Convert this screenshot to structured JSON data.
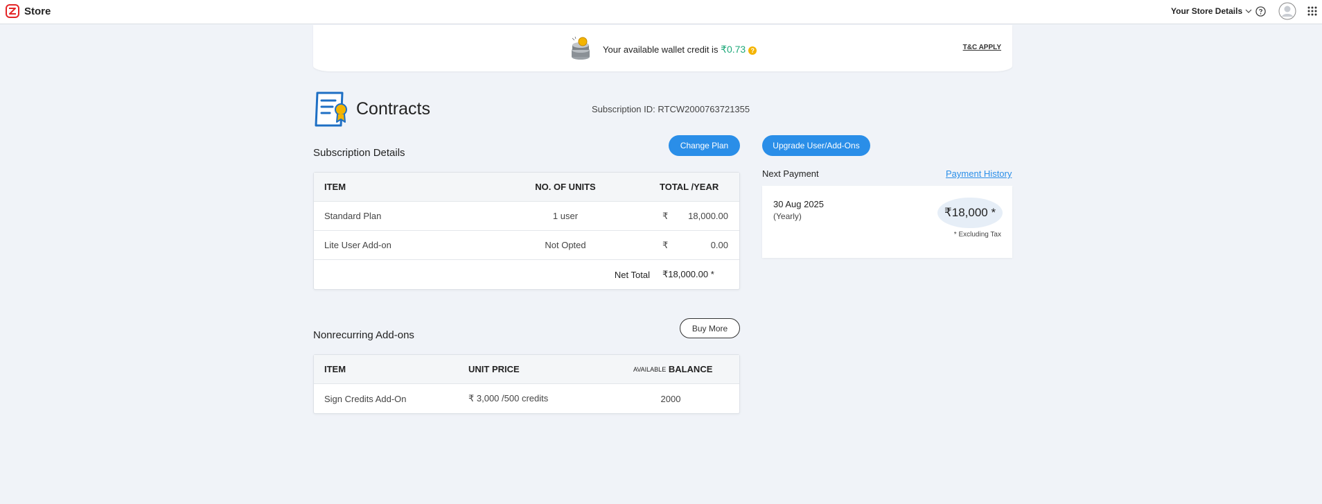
{
  "topbar": {
    "app_name": "Store",
    "store_details_label": "Your Store Details",
    "icons": [
      "store-logo",
      "chevron-down-icon",
      "help-icon",
      "avatar",
      "apps-grid-icon"
    ]
  },
  "wallet": {
    "prefix": "Your available wallet credit is ",
    "amount": "₹0.73",
    "tc_label": "T&C APPLY"
  },
  "page": {
    "title": "Contracts",
    "subscription_id": "Subscription ID: RTCW2000763721355"
  },
  "buttons": {
    "change_plan": "Change Plan",
    "upgrade": "Upgrade User/Add-Ons",
    "buy_more": "Buy More"
  },
  "subscription": {
    "section_title": "Subscription Details",
    "headers": {
      "item": "ITEM",
      "units": "NO. OF UNITS",
      "total": "TOTAL /YEAR"
    },
    "rows": [
      {
        "item": "Standard Plan",
        "units": "1 user",
        "currency": "₹",
        "total": "18,000.00"
      },
      {
        "item": "Lite User Add-on",
        "units": "Not Opted",
        "currency": "₹",
        "total": "0.00"
      }
    ],
    "net_total_label": "Net Total",
    "net_total_value": "₹18,000.00 *"
  },
  "nonrecurring": {
    "section_title": "Nonrecurring Add-ons",
    "headers": {
      "item": "ITEM",
      "unit_price": "UNIT PRICE",
      "balance_prefix": "AVAILABLE",
      "balance": "BALANCE"
    },
    "rows": [
      {
        "item": "Sign Credits Add-On",
        "unit_price": "₹ 3,000 /500 credits",
        "balance": "2000"
      }
    ]
  },
  "next_payment": {
    "label": "Next Payment",
    "history_link": "Payment History",
    "date": "30 Aug 2025",
    "period": "(Yearly)",
    "amount": "₹18,000 *",
    "tax_note": "* Excluding Tax"
  },
  "colors": {
    "accent": "#2a8ee8",
    "wallet_green": "#1fa97a",
    "background": "#f0f3f8"
  }
}
